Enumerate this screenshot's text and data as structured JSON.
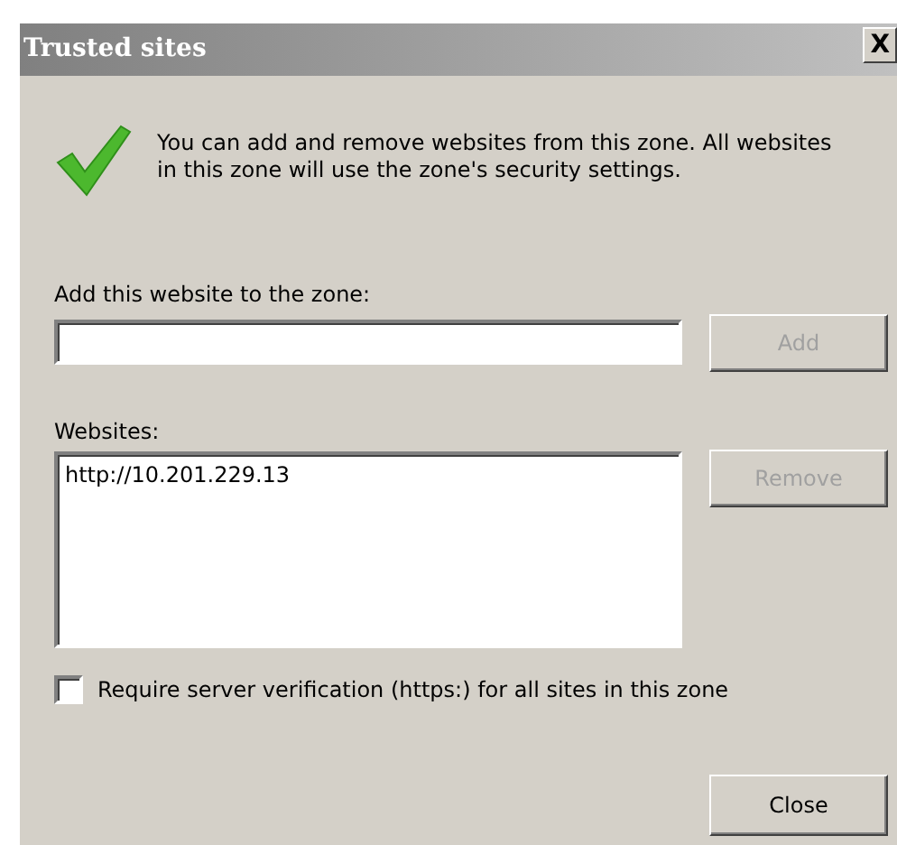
{
  "window": {
    "title": "Trusted sites",
    "close_glyph": "X"
  },
  "info": "You can add and remove websites from this zone. All websites in this zone will use the zone's security settings.",
  "add": {
    "label": "Add this website to the zone:",
    "button": {
      "label": "Add",
      "disabled": true
    }
  },
  "websites": {
    "label": "Websites:",
    "items": [
      {
        "text": "http://10.201.229.13",
        "selected": false
      }
    ],
    "button": {
      "label": "Remove",
      "disabled": true
    }
  },
  "require_https": {
    "label": "Require server verification (https:) for all sites in this zone",
    "checked": false
  },
  "buttons": [
    {
      "label": "Close",
      "disabled": false
    }
  ]
}
